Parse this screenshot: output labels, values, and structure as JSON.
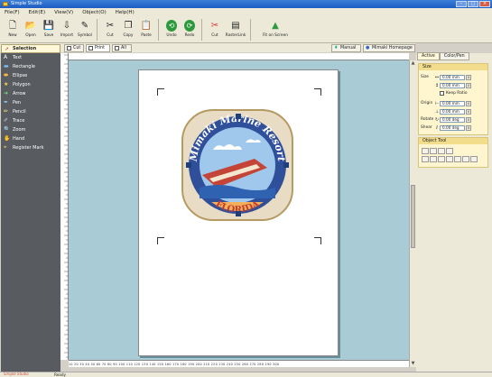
{
  "window": {
    "title": "Simple Studio"
  },
  "menubar": [
    "File(F)",
    "Edit(E)",
    "View(V)",
    "Object(O)",
    "Help(H)"
  ],
  "toolbar": {
    "buttons": [
      {
        "label": "New",
        "icon": "new-doc-icon",
        "glyph": "🗋"
      },
      {
        "label": "Open",
        "icon": "open-folder-icon",
        "glyph": "📂"
      },
      {
        "label": "Save",
        "icon": "save-icon",
        "glyph": "💾"
      },
      {
        "label": "Import",
        "icon": "import-icon",
        "glyph": "⇩"
      },
      {
        "label": "Symbol",
        "icon": "symbol-icon",
        "glyph": "✎"
      },
      {
        "label": "Cut",
        "icon": "scissors-icon",
        "glyph": "✂"
      },
      {
        "label": "Copy",
        "icon": "copy-icon",
        "glyph": "❐"
      },
      {
        "label": "Paste",
        "icon": "paste-icon",
        "glyph": "📋"
      },
      {
        "label": "Undo",
        "icon": "undo-icon",
        "glyph": "⟲"
      },
      {
        "label": "Redo",
        "icon": "redo-icon",
        "glyph": "⟳"
      },
      {
        "label": "Cut",
        "icon": "cut-plot-icon",
        "glyph": "✂"
      },
      {
        "label": "RasterLink",
        "icon": "rasterlink-icon",
        "glyph": "▤"
      },
      {
        "label": "Fit on Screen",
        "icon": "fit-screen-icon",
        "glyph": "▲"
      }
    ]
  },
  "tools": {
    "selected": "Selection",
    "items": [
      {
        "label": "Text",
        "icon": "text-icon",
        "glyph": "A"
      },
      {
        "label": "Rectangle",
        "icon": "rectangle-icon",
        "glyph": "▬"
      },
      {
        "label": "Ellipse",
        "icon": "ellipse-icon",
        "glyph": "⬬"
      },
      {
        "label": "Polygon",
        "icon": "polygon-icon",
        "glyph": "★"
      },
      {
        "label": "Arrow",
        "icon": "arrow-icon",
        "glyph": "➜"
      },
      {
        "label": "Pen",
        "icon": "pen-icon",
        "glyph": "✒"
      },
      {
        "label": "Pencil",
        "icon": "pencil-icon",
        "glyph": "✏"
      },
      {
        "label": "Trace",
        "icon": "trace-icon",
        "glyph": "✐"
      },
      {
        "label": "Zoom",
        "icon": "zoom-icon",
        "glyph": "🔍"
      },
      {
        "label": "Hand",
        "icon": "hand-icon",
        "glyph": "✋"
      },
      {
        "label": "Register Mark",
        "icon": "register-mark-icon",
        "glyph": "⌖"
      }
    ]
  },
  "doc_tabs": [
    {
      "label": "Cut",
      "active": false
    },
    {
      "label": "Print",
      "active": true
    },
    {
      "label": "All",
      "active": false
    }
  ],
  "right_tabs": {
    "manual": "Manual",
    "homepage": "Mimaki Homepage"
  },
  "panel": {
    "tabs": [
      "Active",
      "Color/Pen"
    ],
    "size_group": {
      "title": "Size",
      "size_label": "Size",
      "width": "0.00 mm",
      "height": "0.00 mm",
      "keep_ratio": "Keep Ratio",
      "origin_label": "Origin",
      "origin_x": "0.00 mm",
      "origin_y": "0.00 mm",
      "rotate_label": "Rotate",
      "rotate": "0.00 deg",
      "shear_label": "Shear",
      "shear": "0.00 deg"
    },
    "object_tool": {
      "title": "Object Tool"
    }
  },
  "artwork": {
    "arc_top": "Mimaki Marine Resort",
    "arc_bottom": "FLORIDA"
  },
  "ruler_bottom": "10  20  30  40  50  60  70  80  90  100  110  120  130  140  150  160  170  180  190  200  210  220  230  240  250  260  270  280  290  300",
  "status": {
    "text": "Ready",
    "brand": "Simple Studio"
  }
}
